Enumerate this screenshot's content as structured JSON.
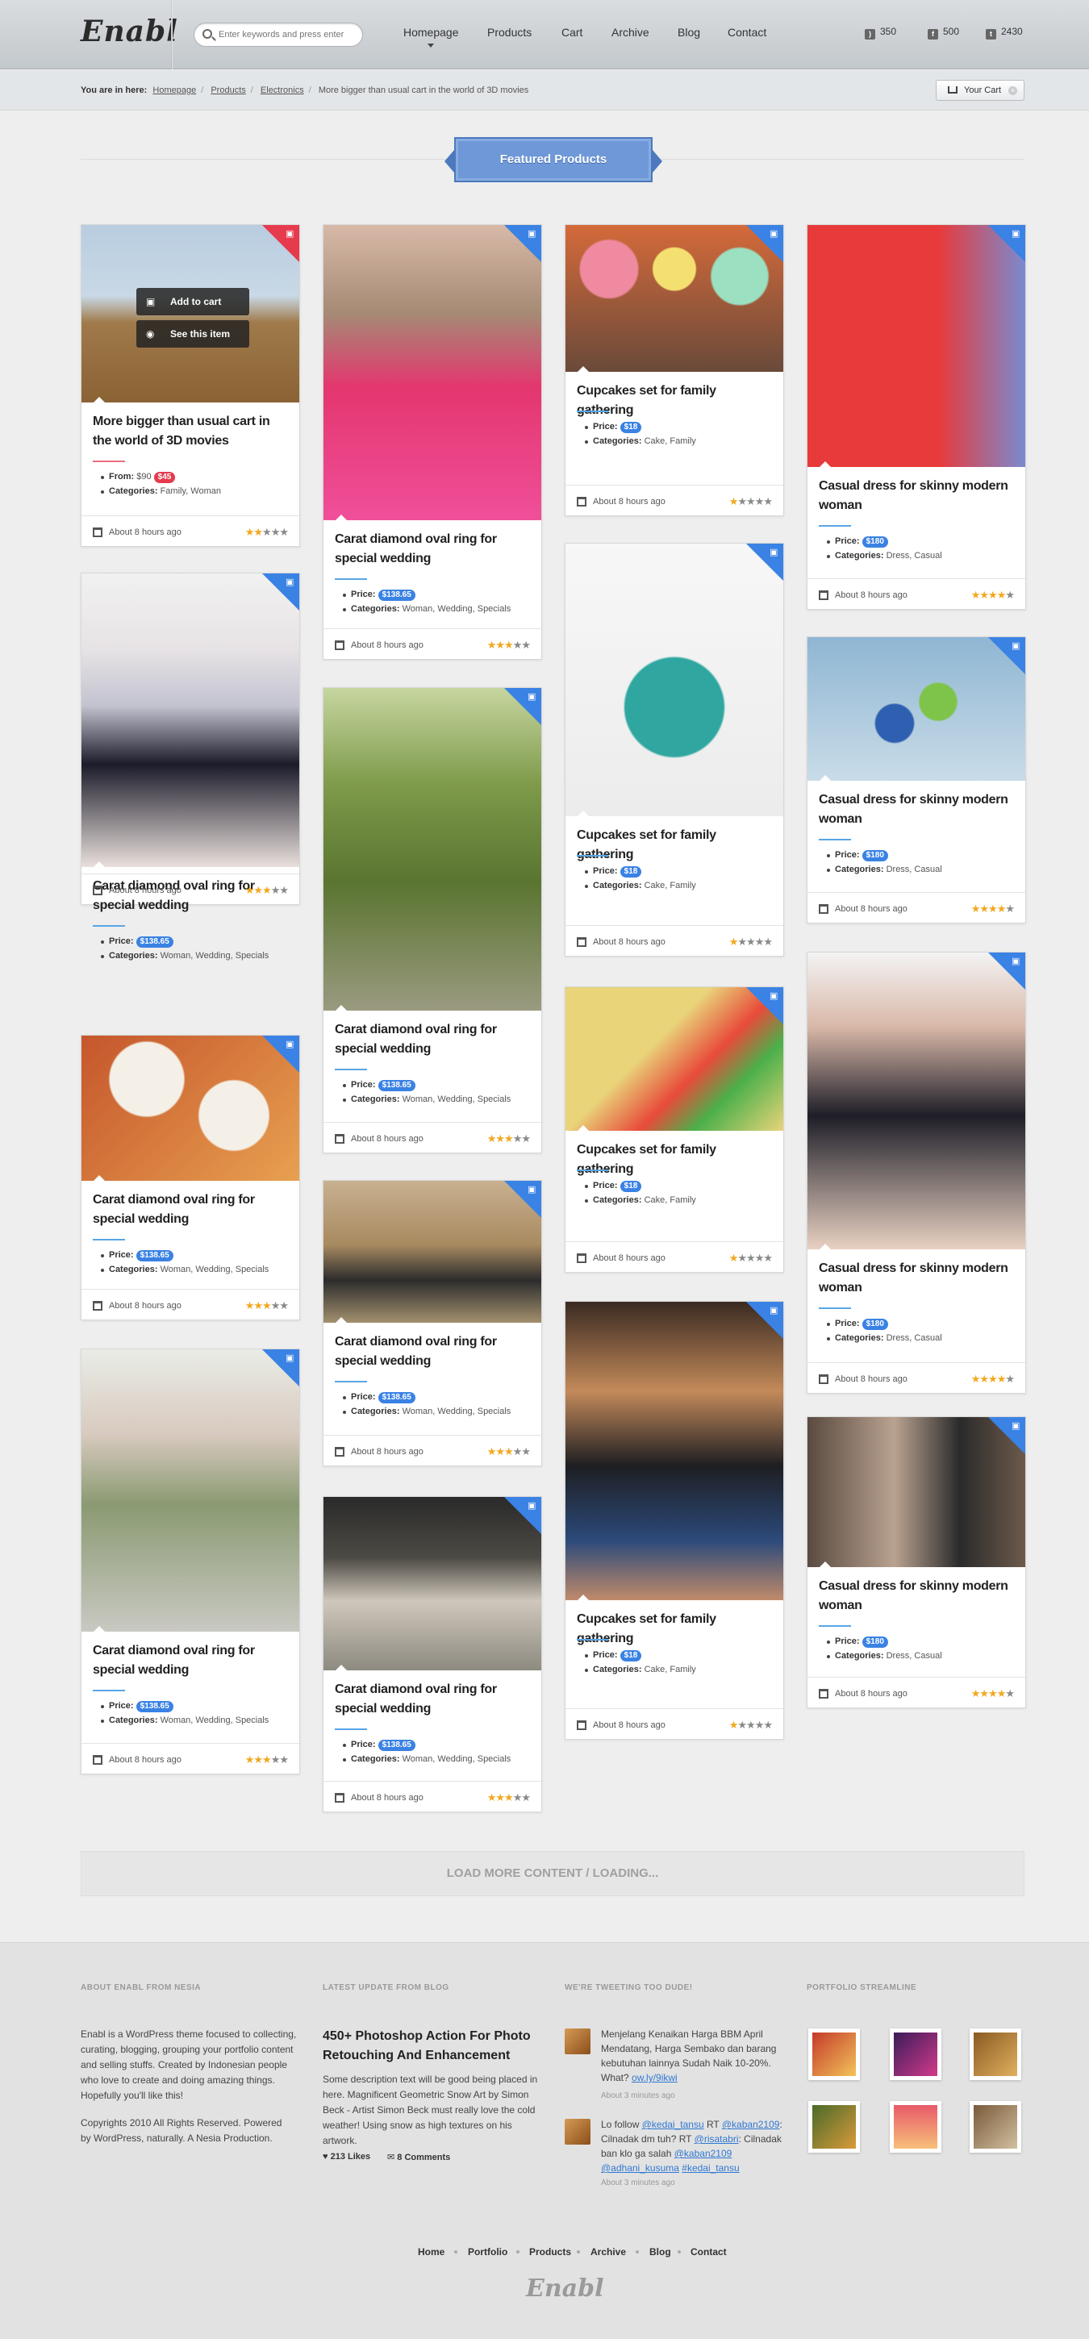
{
  "brand": {
    "logo": "Enabl"
  },
  "search": {
    "placeholder": "Enter keywords and press enter"
  },
  "nav": {
    "items": [
      "Homepage",
      "Products",
      "Cart",
      "Archive",
      "Blog",
      "Contact"
    ]
  },
  "stats": {
    "rss": "350",
    "facebook": "500",
    "twitter": "2430"
  },
  "breadcrumb": {
    "prefix": "You are in here:",
    "items": [
      "Homepage",
      "Products",
      "Electronics"
    ],
    "current": "More bigger than usual cart in the world of 3D movies"
  },
  "cart": {
    "label": "Your Cart"
  },
  "section": {
    "title": "Featured Products"
  },
  "overlay": {
    "add": "Add to cart",
    "see": "See this item"
  },
  "labels": {
    "price": "Price:",
    "from": "From:",
    "categories": "Categories:"
  },
  "products": [
    {
      "title": "More bigger than usual cart in the world of 3D movies",
      "old_price": "$90",
      "price": "$45",
      "categories": "Family, Woman",
      "time": "About 8 hours ago",
      "rating": 2
    },
    {
      "title": "Carat diamond oval ring for special wedding",
      "price": "$138.65",
      "categories": "Woman, Wedding, Specials",
      "time": "About 8 hours ago",
      "rating": 3
    },
    {
      "title": "Carat diamond oval ring for special wedding",
      "price": "$138.65",
      "categories": "Woman, Wedding, Specials",
      "time": "About 8 hours ago",
      "rating": 3
    },
    {
      "title": "Carat diamond oval ring for special wedding",
      "price": "$138.65",
      "categories": "Woman, Wedding, Specials",
      "time": "About 8 hours ago",
      "rating": 3
    },
    {
      "title": "Carat diamond oval ring for special wedding",
      "price": "$138.65",
      "categories": "Woman, Wedding, Specials",
      "time": "About 8 hours ago",
      "rating": 3
    },
    {
      "title": "Carat diamond oval ring for special wedding",
      "price": "$138.65",
      "categories": "Woman, Wedding, Specials",
      "time": "About 8 hours ago",
      "rating": 3
    },
    {
      "title": "Carat diamond oval ring for special wedding",
      "price": "$138.65",
      "categories": "Woman, Wedding, Specials",
      "time": "About 8 hours ago",
      "rating": 3
    },
    {
      "title": "Carat diamond oval ring for special wedding",
      "price": "$138.65",
      "categories": "Woman, Wedding, Specials",
      "time": "About 8 hours ago",
      "rating": 3
    },
    {
      "title": "Cupcakes set for family gathering",
      "price": "$18",
      "categories": "Cake, Family",
      "time": "About 8 hours ago",
      "rating": 1
    },
    {
      "title": "Cupcakes set for family gathering",
      "price": "$18",
      "categories": "Cake, Family",
      "time": "About 8 hours ago",
      "rating": 1
    },
    {
      "title": "Cupcakes set for family gathering",
      "price": "$18",
      "categories": "Cake, Family",
      "time": "About 8 hours ago",
      "rating": 1
    },
    {
      "title": "Cupcakes set for family gathering",
      "price": "$18",
      "categories": "Cake, Family",
      "time": "About 8 hours ago",
      "rating": 1
    },
    {
      "title": "Casual dress for skinny modern woman",
      "price": "$180",
      "categories": "Dress, Casual",
      "time": "About 8 hours ago",
      "rating": 4
    },
    {
      "title": "Casual dress for skinny modern woman",
      "price": "$180",
      "categories": "Dress, Casual",
      "time": "About 8 hours ago",
      "rating": 4
    },
    {
      "title": "Casual dress for skinny modern woman",
      "price": "$180",
      "categories": "Dress, Casual",
      "time": "About 8 hours ago",
      "rating": 4
    },
    {
      "title": "Casual dress for skinny modern woman",
      "price": "$180",
      "categories": "Dress, Casual",
      "time": "About 8 hours ago",
      "rating": 4
    }
  ],
  "load_more": "LOAD MORE CONTENT / LOADING...",
  "footer": {
    "about": {
      "heading": "ABOUT ENABL FROM NESIA",
      "text": "Enabl is a WordPress theme focused to collecting, curating, blogging, grouping your portfolio content and selling stuffs. Created by Indonesian people who love to create and doing amazing things. Hopefully you'll like this!",
      "copyright": "Copyrights 2010 All Rights Reserved. Powered by WordPress, naturally. A Nesia Production."
    },
    "blog": {
      "heading": "LATEST UPDATE FROM BLOG",
      "title": "450+ Photoshop Action For Photo Retouching And Enhancement",
      "text": "Some description text will be good being placed in here. Magnificent Geometric Snow Art by Simon Beck - Artist Simon Beck must really love the cold weather! Using snow as high textures on his artwork.",
      "likes": "213 Likes",
      "comments": "8 Comments"
    },
    "tweets": {
      "heading": "WE'RE TWEETING TOO DUDE!",
      "t1": "Menjelang Kenaikan Harga BBM April Mendatang, Harga Sembako dan barang kebutuhan lainnya Sudah Naik 10-20%. What?",
      "t1_link": "ow.ly/9ikwi",
      "t1_time": "About 3 minutes ago",
      "t2_a": "Lo follow",
      "t2_u1": "@kedai_tansu",
      "t2_b": "RT",
      "t2_u2": "@kaban2109",
      "t2_c": ": Cilnadak dm tuh? RT",
      "t2_u3": "@risatabri",
      "t2_d": ": Cilnadak ban klo ga salah",
      "t2_u4": "@kaban2109",
      "t2_u5": "@adhani_kusuma",
      "t2_u6": "#kedai_tansu",
      "t2_time": "About 3 minutes ago"
    },
    "portfolio": {
      "heading": "PORTFOLIO STREAMLINE"
    },
    "nav": [
      "Home",
      "Portfolio",
      "Products",
      "Archive",
      "Blog",
      "Contact"
    ],
    "logo": "Enabl"
  },
  "colors": {
    "accent": "#3a82e4",
    "sale": "#e63a4d",
    "star": "#f2a81e"
  }
}
